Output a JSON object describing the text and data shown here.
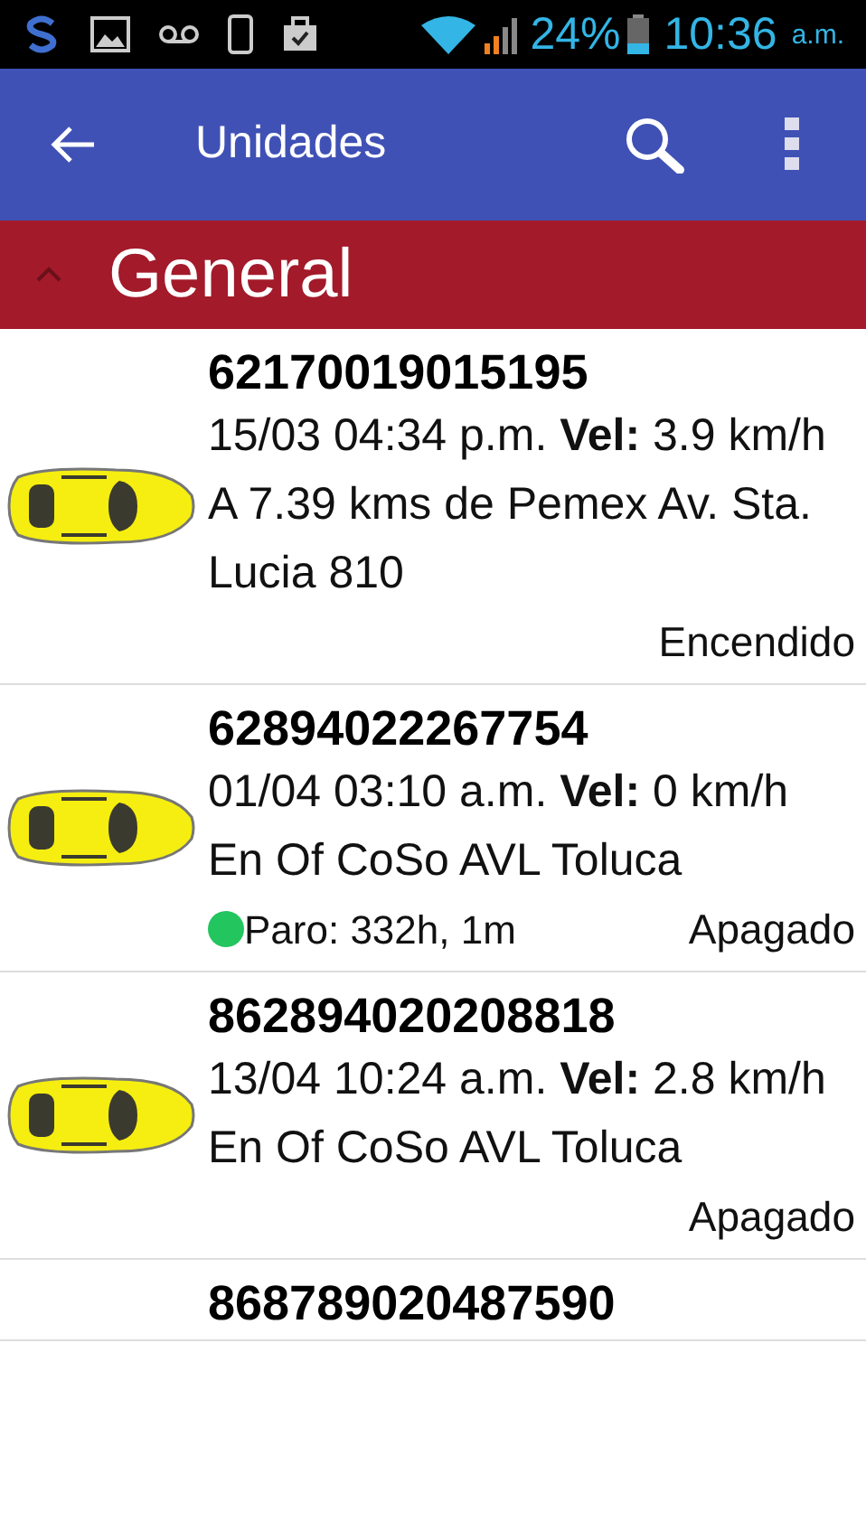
{
  "status_bar": {
    "battery_text": "24%",
    "time": "10:36",
    "time_suffix": "a.m."
  },
  "app_bar": {
    "title": "Unidades"
  },
  "group": {
    "title": "General",
    "expanded": true
  },
  "units": [
    {
      "id": "62170019015195",
      "details": "15/03 04:34 p.m. **Vel:** 3.9 km/h",
      "address": "A 7.39 kms de Pemex Av. Sta. Lucia 810",
      "state": "Encendido"
    },
    {
      "id": "62894022267754",
      "details": "01/04 03:10 a.m. **Vel:** 0 km/h",
      "address": "En Of CoSo AVL Toluca",
      "stop": {
        "text": "Paro: 332h, 1m",
        "color": "#22c55e"
      },
      "state": "Apagado"
    },
    {
      "id": "862894020208818",
      "details": "13/04 10:24 a.m. **Vel:** 2.8 km/h",
      "address": "En Of CoSo AVL Toluca",
      "state": "Apagado"
    },
    {
      "id": "868789020487590"
    }
  ]
}
